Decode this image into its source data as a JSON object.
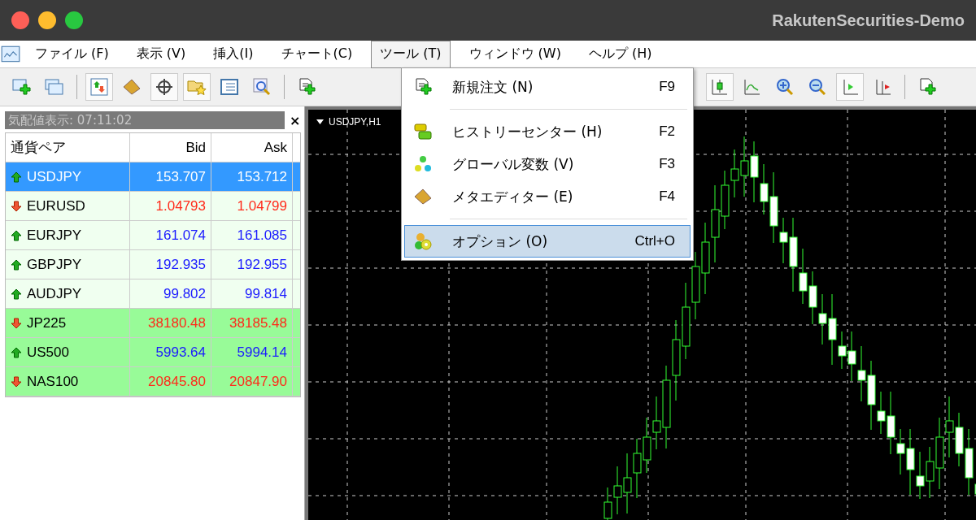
{
  "window": {
    "title": "RakutenSecurities-Demo"
  },
  "menu_bar": [
    {
      "label": "ファイル (F)",
      "selected": false
    },
    {
      "label": "表示 (V)",
      "selected": false
    },
    {
      "label": "挿入(I)",
      "selected": false
    },
    {
      "label": "チャート(C)",
      "selected": false
    },
    {
      "label": "ツール (T)",
      "selected": true
    },
    {
      "label": "ウィンドウ (W)",
      "selected": false
    },
    {
      "label": "ヘルプ (H)",
      "selected": false
    }
  ],
  "tools_menu": [
    {
      "label": "新規注文 (N)",
      "shortcut": "F9",
      "selected": false,
      "kind": "order"
    },
    {
      "label": "ヒストリーセンター (H)",
      "shortcut": "F2",
      "selected": false,
      "kind": "history"
    },
    {
      "label": "グローバル変数 (V)",
      "shortcut": "F3",
      "selected": false,
      "kind": "variables"
    },
    {
      "label": "メタエディター (E)",
      "shortcut": "F4",
      "selected": false,
      "kind": "editor"
    },
    {
      "label": "オプション (O)",
      "shortcut": "Ctrl+O",
      "selected": true,
      "kind": "options"
    }
  ],
  "market_watch": {
    "title": "気配値表示: 07:11:02",
    "close": "×",
    "columns": [
      "通貨ペア",
      "Bid",
      "Ask"
    ],
    "rows": [
      {
        "symbol": "USDJPY",
        "bid": "153.707",
        "ask": "153.712",
        "kind": "up",
        "selected": true
      },
      {
        "symbol": "EURUSD",
        "bid": "1.04793",
        "ask": "1.04799",
        "kind": "down",
        "selected": false,
        "color": "#f0fff0"
      },
      {
        "symbol": "EURJPY",
        "bid": "161.074",
        "ask": "161.085",
        "kind": "up",
        "selected": false,
        "color": "#f0fff0"
      },
      {
        "symbol": "GBPJPY",
        "bid": "192.935",
        "ask": "192.955",
        "kind": "up",
        "selected": false,
        "color": "#f0fff0"
      },
      {
        "symbol": "AUDJPY",
        "bid": "99.802",
        "ask": "99.814",
        "kind": "up",
        "selected": false,
        "color": "#f0fff0"
      },
      {
        "symbol": "JP225",
        "bid": "38180.48",
        "ask": "38185.48",
        "kind": "down",
        "selected": false,
        "color": "#98fb98"
      },
      {
        "symbol": "US500",
        "bid": "5993.64",
        "ask": "5994.14",
        "kind": "up",
        "selected": false,
        "color": "#98fb98"
      },
      {
        "symbol": "NAS100",
        "bid": "20845.80",
        "ask": "20847.90",
        "kind": "down",
        "selected": false,
        "color": "#98fb98"
      }
    ]
  },
  "chart": {
    "label": "USDJPY,H1"
  }
}
